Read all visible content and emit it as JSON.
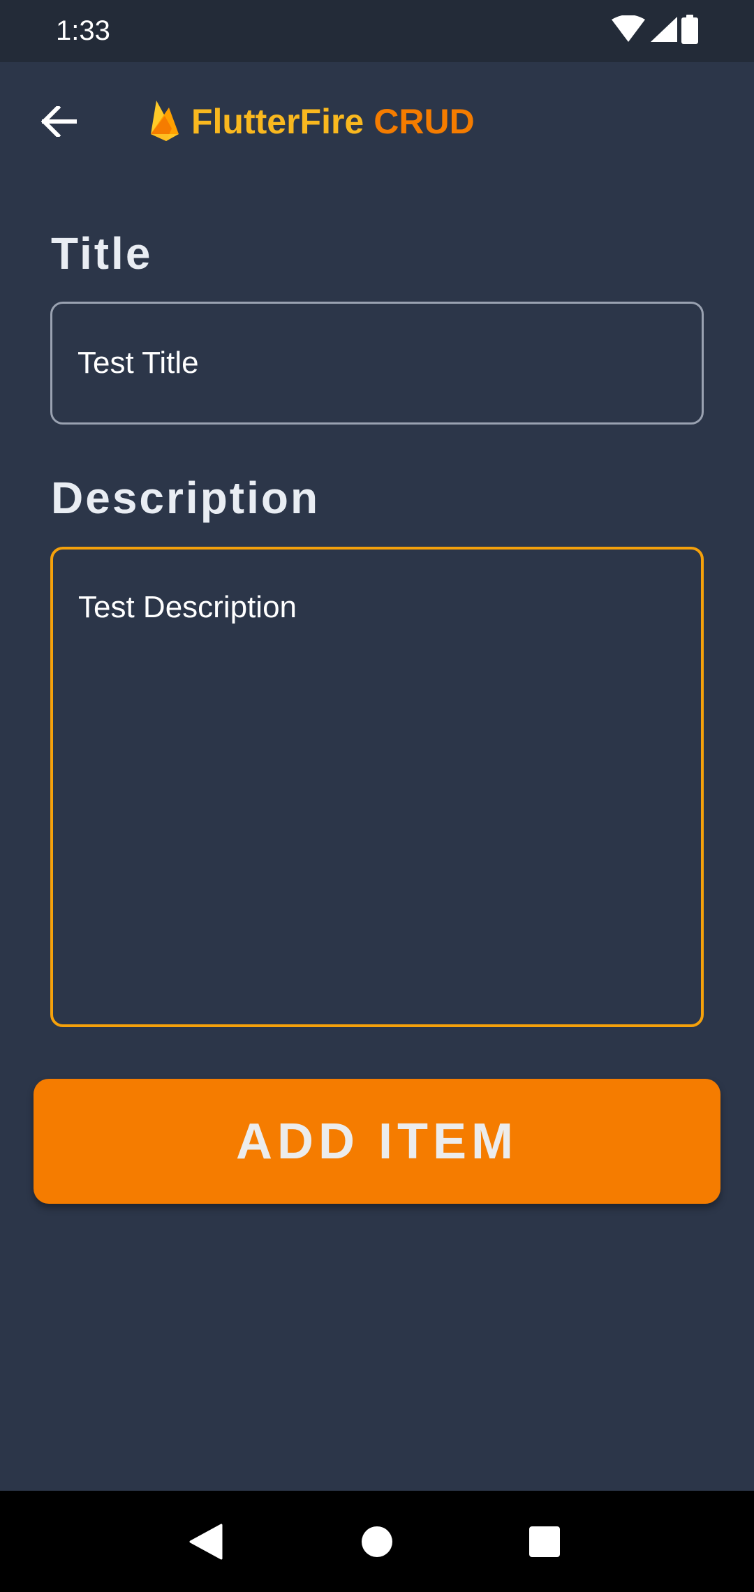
{
  "status_bar": {
    "time": "1:33",
    "icons": [
      "wifi-icon",
      "cell-signal-icon",
      "battery-icon"
    ]
  },
  "app_bar": {
    "back_icon": "arrow-back-icon",
    "logo_icon": "firebase-flame-icon",
    "title_part1": "FlutterFire",
    "title_part2": "CRUD",
    "colors": {
      "part1": "#f9b81f",
      "part2": "#f57c00"
    }
  },
  "form": {
    "title_label": "Title",
    "title_value": "Test Title",
    "description_label": "Description",
    "description_value": "Test Description",
    "focused_border_color": "#f5a10b",
    "idle_border_color": "#9aa2b1"
  },
  "add_button": {
    "label": "ADD ITEM",
    "color": "#f57c00"
  },
  "nav_bar": {
    "items": [
      "back-triangle-icon",
      "home-circle-icon",
      "recents-square-icon"
    ]
  }
}
